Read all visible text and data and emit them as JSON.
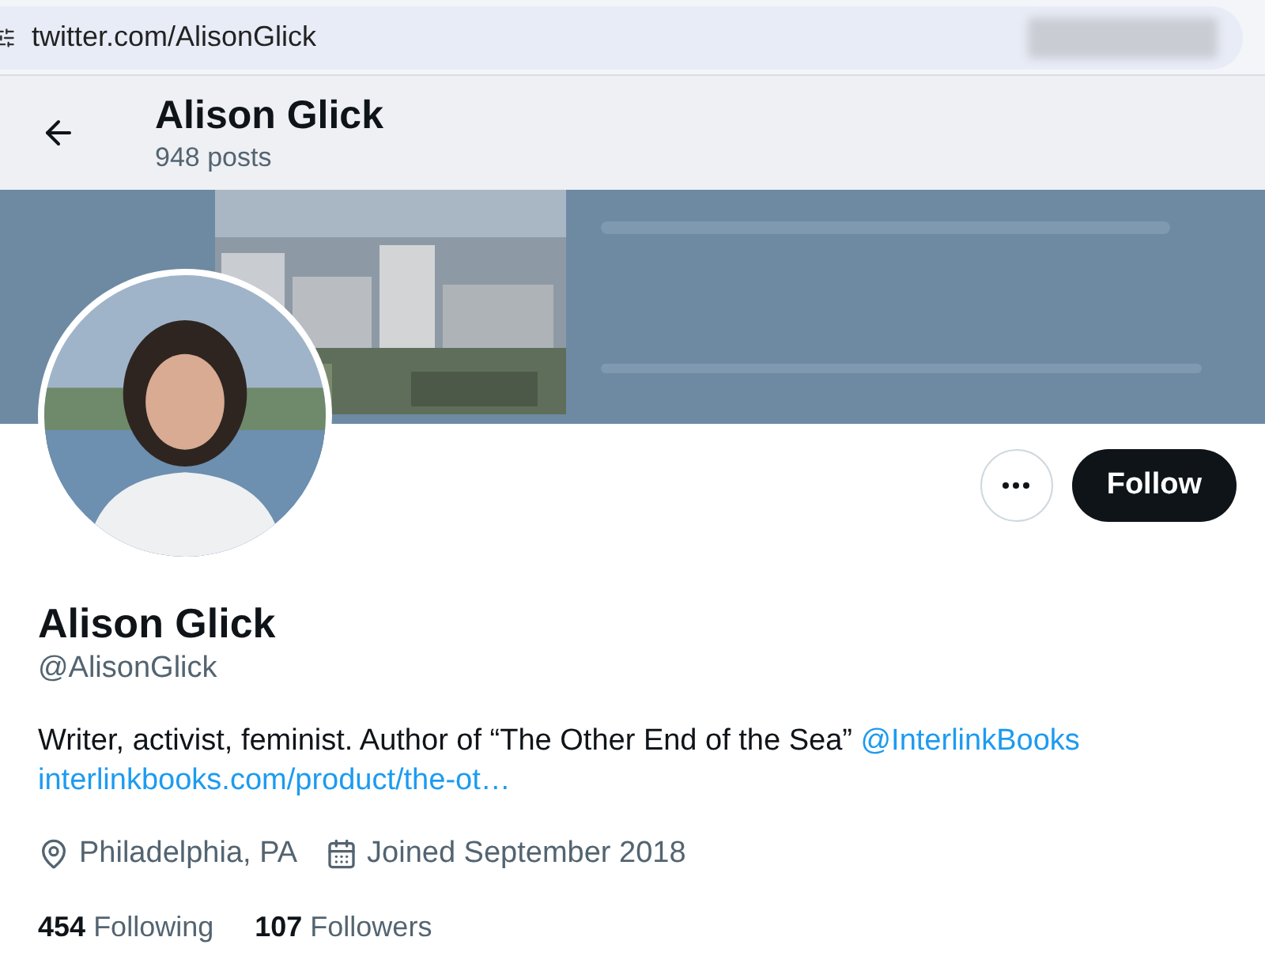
{
  "address_bar": {
    "url": "twitter.com/AlisonGlick"
  },
  "header": {
    "name": "Alison Glick",
    "posts": "948 posts"
  },
  "actions": {
    "follow": "Follow"
  },
  "profile": {
    "name": "Alison Glick",
    "handle": "@AlisonGlick"
  },
  "bio": {
    "text": "Writer, activist, feminist. Author of “The Other End of the Sea”",
    "mention": "@InterlinkBooks",
    "link": "interlinkbooks.com/product/the-ot…"
  },
  "meta": [
    {
      "kind": "location",
      "text": "Philadelphia, PA"
    },
    {
      "kind": "joined",
      "text": "Joined September 2018"
    }
  ],
  "stats": [
    {
      "count": "454",
      "label": "Following"
    },
    {
      "count": "107",
      "label": "Followers"
    }
  ]
}
